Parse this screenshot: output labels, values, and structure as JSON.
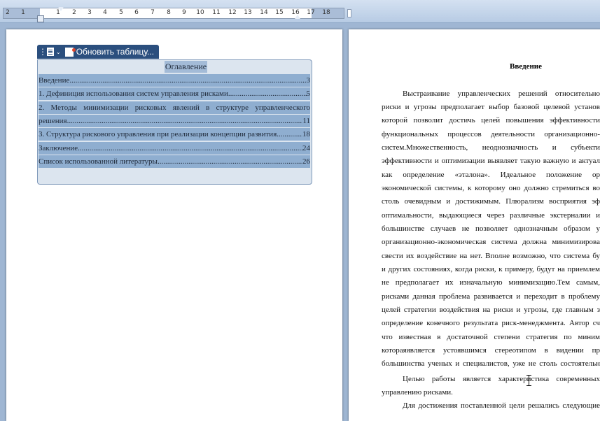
{
  "ruler": {
    "numbers": [
      "2",
      "1",
      "1",
      "2",
      "3",
      "4",
      "5",
      "6",
      "7",
      "8",
      "9",
      "10",
      "11",
      "12",
      "13",
      "14",
      "15",
      "16",
      "17",
      "18"
    ]
  },
  "toc_toolbar": {
    "update_label": "Обновить таблицу..."
  },
  "toc": {
    "heading": "Оглавление",
    "entries": [
      {
        "title": "Введение",
        "page": "3"
      },
      {
        "title": "1. Дефиниция использования систем управления рисками",
        "page": "5"
      },
      {
        "title": "2. Методы минимизации рисковых явлений в структуре управленческого",
        "page": ""
      },
      {
        "title": "решения",
        "page": "11"
      },
      {
        "title": "3. Структура рискового управления при реализации концепции развития",
        "page": "18"
      },
      {
        "title": "Заключение",
        "page": "24"
      },
      {
        "title": "Список использованной литературы",
        "page": "26"
      }
    ]
  },
  "document": {
    "title": "Введение",
    "lines": [
      "Выстраивание управленческих решений относительно",
      "риски и угрозы предполагает выбор базовой целевой установ",
      "которой позволит достичь целей повышения эффективности",
      "функциональных процессов деятельности организационно-",
      "систем.Множественность, неоднозначность и субъекти",
      "эффективности и оптимизации выявляет такую важную и актуал",
      "как определение «эталона». Идеальное положение ор",
      "экономической системы, к которому оно должно стремиться во",
      "столь очевидным и достижимым. Плюрализм восприятия эф",
      "оптимальности, выдающиеся через различные экстерналии и",
      "большинстве случаев не позволяет однозначным образом у",
      "организационно-экономическая система должна минимизирова",
      "свести их воздействие на нет. Вполне возможно, что система бу",
      "и других состояниях, когда риски, к примеру, будут на приемлем",
      "не предполагает их изначальную минимизацию.Тем самым,",
      "рисками данная проблема развивается и переходит в проблему",
      "целей стратегии воздействия на риски и угрозы, где главным з",
      "определение конечного результата риск-менеджмента. Автор сч",
      "что известная в достаточной степени стратегия по миним",
      "котораяявляется устоявшимся стереотипом в видении пр",
      "большинства ученых и специалистов, уже не столь состоятельн",
      "Целью работы является характеристика современных",
      "управлению рисками.",
      "Для достижения поставленной цели решались следующие"
    ]
  }
}
